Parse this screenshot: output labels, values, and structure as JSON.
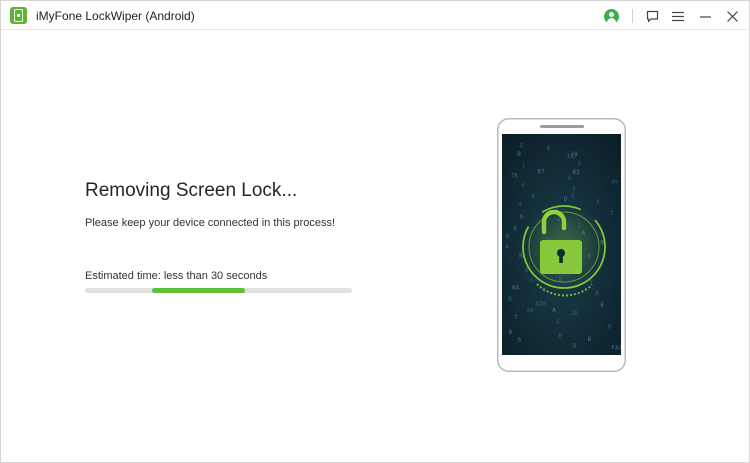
{
  "window": {
    "title": "iMyFone LockWiper (Android)"
  },
  "titlebar": {
    "icons": [
      "account-icon",
      "feedback-icon",
      "menu-icon",
      "minimize-icon",
      "close-icon"
    ]
  },
  "main": {
    "heading": "Removing Screen Lock...",
    "subtext": "Please keep your device connected in this process!",
    "estimated_time": "Estimated time: less than 30 seconds",
    "progress": {
      "start": 0.25,
      "end": 0.6
    }
  },
  "colors": {
    "accent_green": "#5ec139",
    "account_green": "#3bb04a",
    "screen_bg": "#0f2a36",
    "lock_green": "#7fc63a"
  },
  "phone_screen_glyphs": [
    "B",
    "6",
    "10",
    "B",
    "187",
    "8",
    "1",
    "B7",
    "83",
    "78",
    "A",
    "PF",
    "8",
    "5",
    "4",
    "B",
    "D",
    "E",
    "4",
    "8",
    "3",
    "6",
    "4",
    "2",
    "8",
    "A",
    "B",
    "B",
    "3",
    "B",
    "A",
    "BA78",
    "E",
    "B",
    "D",
    "2",
    "B",
    "E",
    "25",
    "6",
    "B",
    "5",
    "8A",
    "8",
    "8",
    "B",
    "A28",
    "8",
    "2A",
    "A",
    "2B",
    "5",
    "5",
    "8",
    "B",
    "E",
    "B",
    "6",
    "8",
    "FA1"
  ]
}
